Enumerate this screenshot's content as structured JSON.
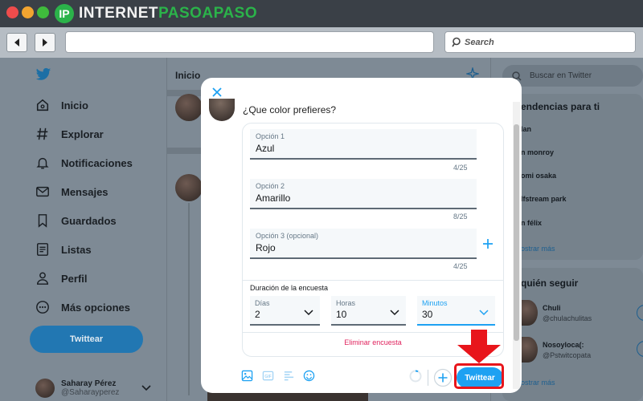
{
  "site_logo": {
    "mark": "IP",
    "text_part1": "INTERNET",
    "text_part2": "PASOAPASO"
  },
  "browser": {
    "search_placeholder": "Search"
  },
  "twitter": {
    "header_title": "Inicio",
    "nav": [
      {
        "label": "Inicio",
        "icon": "home-icon"
      },
      {
        "label": "Explorar",
        "icon": "hashtag-icon"
      },
      {
        "label": "Notificaciones",
        "icon": "bell-icon"
      },
      {
        "label": "Mensajes",
        "icon": "mail-icon"
      },
      {
        "label": "Guardados",
        "icon": "bookmark-icon"
      },
      {
        "label": "Listas",
        "icon": "list-icon"
      },
      {
        "label": "Perfil",
        "icon": "person-icon"
      },
      {
        "label": "Más opciones",
        "icon": "more-icon"
      }
    ],
    "tweet_button": "Twittear",
    "profile": {
      "name": "Saharay Pérez",
      "handle": "@Saharayperez"
    },
    "right": {
      "search_placeholder": "Buscar en Twitter",
      "trends_title": "endencias para ti",
      "trends": [
        "lan",
        "n monroy",
        "omi osaka",
        "lfstream park",
        "n félix"
      ],
      "show_more": "ostrar más",
      "follow_title": "quién seguir",
      "follow": [
        {
          "name": "Chuli",
          "handle": "@chulachulitas"
        },
        {
          "name": "Nosoyloca(:",
          "handle": "@Pstwitcopata"
        }
      ],
      "show_more_2": "ostrar más"
    }
  },
  "compose": {
    "question": "¿Que color prefieres?",
    "options": [
      {
        "label": "Opción 1",
        "value": "Azul",
        "counter": "4/25"
      },
      {
        "label": "Opción 2",
        "value": "Amarillo",
        "counter": "8/25"
      },
      {
        "label": "Opción 3 (opcional)",
        "value": "Rojo",
        "counter": "4/25"
      }
    ],
    "duration_label": "Duración de la encuesta",
    "duration": {
      "days": {
        "label": "Días",
        "value": "2"
      },
      "hours": {
        "label": "Horas",
        "value": "10"
      },
      "minutes": {
        "label": "Minutos",
        "value": "30"
      }
    },
    "remove_poll": "Eliminar encuesta",
    "submit": "Twittear",
    "toolbar_icons": [
      "image-icon",
      "gif-icon",
      "poll-icon",
      "emoji-icon"
    ]
  },
  "colors": {
    "twitter_blue": "#1da1f2",
    "highlight_red": "#e8151b",
    "remove_red": "#e0245e"
  }
}
